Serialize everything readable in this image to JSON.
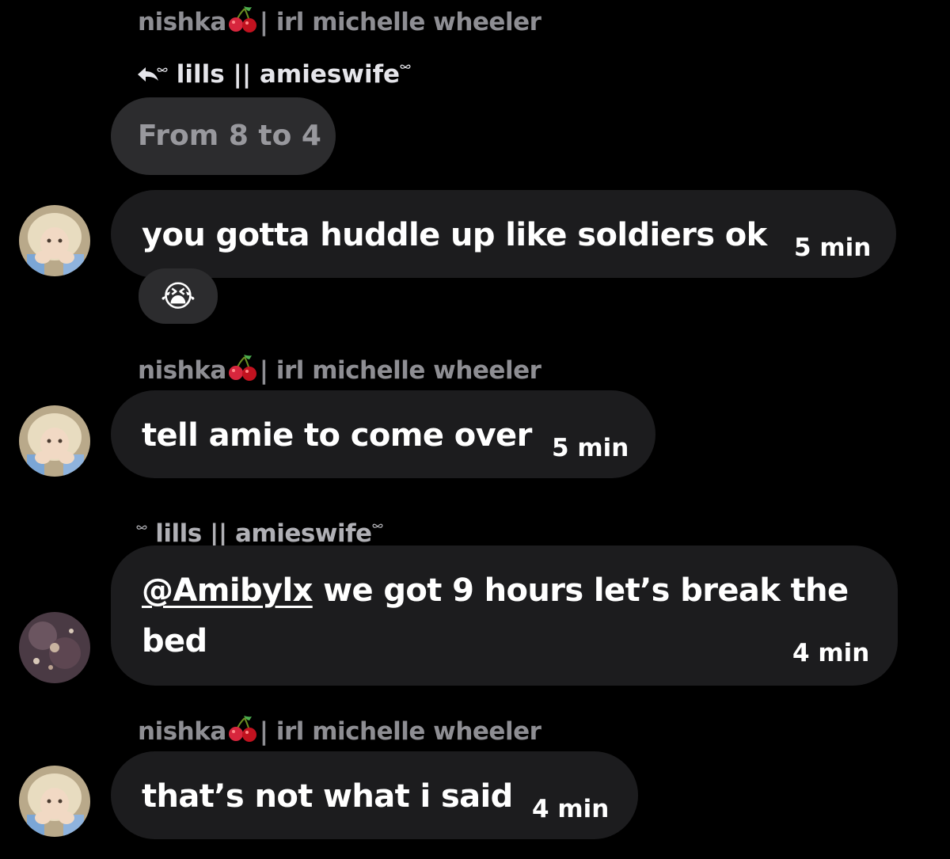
{
  "header": {
    "sender": "nishka",
    "sender_suffix": "| irl michelle wheeler",
    "reply_to": "lills || amieswife",
    "quoted_text": "From 8 to 4"
  },
  "messages": [
    {
      "text": "you gotta huddle up like soldiers ok",
      "time": "5 min",
      "reaction": "😭"
    },
    {
      "sender": "nishka",
      "sender_suffix": "| irl michelle wheeler",
      "text": "tell amie to come over",
      "time": "5 min"
    },
    {
      "sender": "lills || amieswife",
      "mention": "@Amibylx",
      "text_line1": " we got 9 hours let’s break the",
      "text_line2": "bed",
      "time": "4 min"
    },
    {
      "sender": "nishka",
      "sender_suffix": "| irl michelle wheeler",
      "text": "that’s not what i said",
      "time": "4 min"
    }
  ],
  "colors": {
    "background": "#000000",
    "bubble": "#1c1c1e",
    "quoted_bubble": "#2c2c2e",
    "sender_gray": "#8e8e93"
  }
}
